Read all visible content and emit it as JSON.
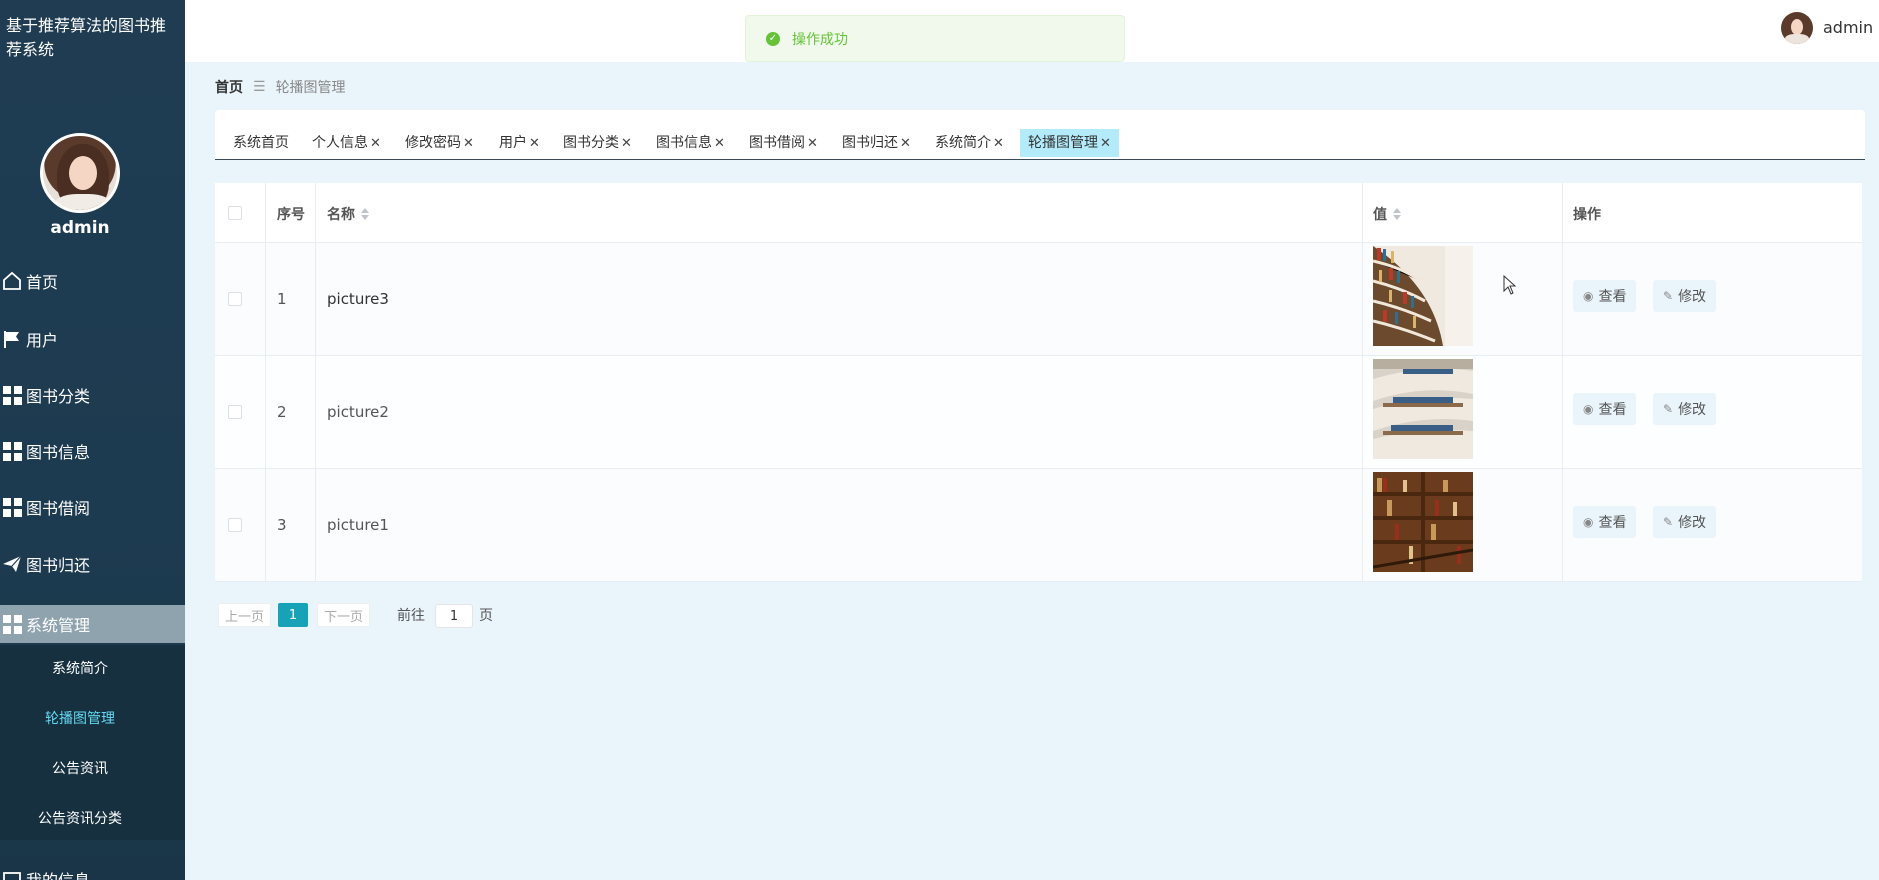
{
  "app": {
    "title": "基于推荐算法的图书推荐系统"
  },
  "sidebar": {
    "username": "admin",
    "items": [
      {
        "label": "首页",
        "icon": "home-icon"
      },
      {
        "label": "用户",
        "icon": "flag-icon"
      },
      {
        "label": "图书分类",
        "icon": "grid-icon"
      },
      {
        "label": "图书信息",
        "icon": "grid-icon"
      },
      {
        "label": "图书借阅",
        "icon": "grid-icon"
      },
      {
        "label": "图书归还",
        "icon": "send-icon"
      },
      {
        "label": "系统管理",
        "icon": "grid-icon"
      }
    ],
    "subitems": [
      {
        "label": "系统简介"
      },
      {
        "label": "轮播图管理"
      },
      {
        "label": "公告资讯"
      },
      {
        "label": "公告资讯分类"
      }
    ],
    "partial_item": "我的信息"
  },
  "topbar": {
    "username": "admin"
  },
  "toast": {
    "message": "操作成功",
    "color": "#67c23a"
  },
  "breadcrumb": {
    "home": "首页",
    "current": "轮播图管理"
  },
  "tabs": [
    {
      "label": "系统首页",
      "closable": false
    },
    {
      "label": "个人信息",
      "closable": true
    },
    {
      "label": "修改密码",
      "closable": true
    },
    {
      "label": "用户",
      "closable": true
    },
    {
      "label": "图书分类",
      "closable": true
    },
    {
      "label": "图书信息",
      "closable": true
    },
    {
      "label": "图书借阅",
      "closable": true
    },
    {
      "label": "图书归还",
      "closable": true
    },
    {
      "label": "系统简介",
      "closable": true
    },
    {
      "label": "轮播图管理",
      "closable": true
    }
  ],
  "table": {
    "headers": {
      "index": "序号",
      "name": "名称",
      "value": "值",
      "actions": "操作"
    },
    "rows": [
      {
        "index": "1",
        "name": "picture3"
      },
      {
        "index": "2",
        "name": "picture2"
      },
      {
        "index": "3",
        "name": "picture1"
      }
    ],
    "view_label": "查看",
    "edit_label": "修改"
  },
  "pagination": {
    "prev": "上一页",
    "current": "1",
    "next": "下一页",
    "goto_label": "前往",
    "page_value": "1",
    "page_suffix": "页"
  },
  "colors": {
    "sidebar": "#1f3c52",
    "accent": "#17a2b8",
    "active_tab": "#b3ebfa",
    "page_bg": "#eaf4fb"
  }
}
